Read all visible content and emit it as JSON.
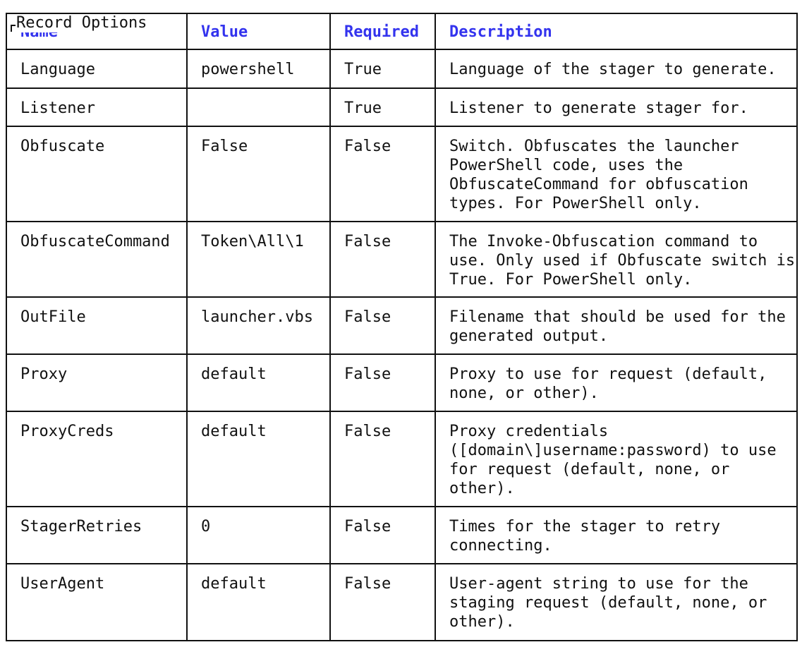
{
  "panel": {
    "title": "Record Options"
  },
  "colors": {
    "header_text": "#3333ee",
    "body_text": "#111111",
    "border": "#111111",
    "background": "#ffffff"
  },
  "table": {
    "columns": [
      "Name",
      "Value",
      "Required",
      "Description"
    ],
    "rows": [
      {
        "name": "Language",
        "value": "powershell",
        "required": "True",
        "description": "Language of the stager to generate."
      },
      {
        "name": "Listener",
        "value": "",
        "required": "True",
        "description": "Listener to generate stager for."
      },
      {
        "name": "Obfuscate",
        "value": "False",
        "required": "False",
        "description": "Switch. Obfuscates the launcher PowerShell code, uses the ObfuscateCommand for obfuscation types. For PowerShell only."
      },
      {
        "name": "ObfuscateCommand",
        "value": "Token\\All\\1",
        "required": "False",
        "description": "The Invoke-Obfuscation command to use. Only used if Obfuscate switch is True. For PowerShell only."
      },
      {
        "name": "OutFile",
        "value": "launcher.vbs",
        "required": "False",
        "description": "Filename that should be used for the generated output."
      },
      {
        "name": "Proxy",
        "value": "default",
        "required": "False",
        "description": "Proxy to use for request (default, none, or other)."
      },
      {
        "name": "ProxyCreds",
        "value": "default",
        "required": "False",
        "description": "Proxy credentials ([domain\\]username:password) to use for request (default, none, or other)."
      },
      {
        "name": "StagerRetries",
        "value": "0",
        "required": "False",
        "description": "Times for the stager to retry connecting."
      },
      {
        "name": "UserAgent",
        "value": "default",
        "required": "False",
        "description": "User-agent string to use for the staging request (default, none, or other)."
      }
    ]
  }
}
